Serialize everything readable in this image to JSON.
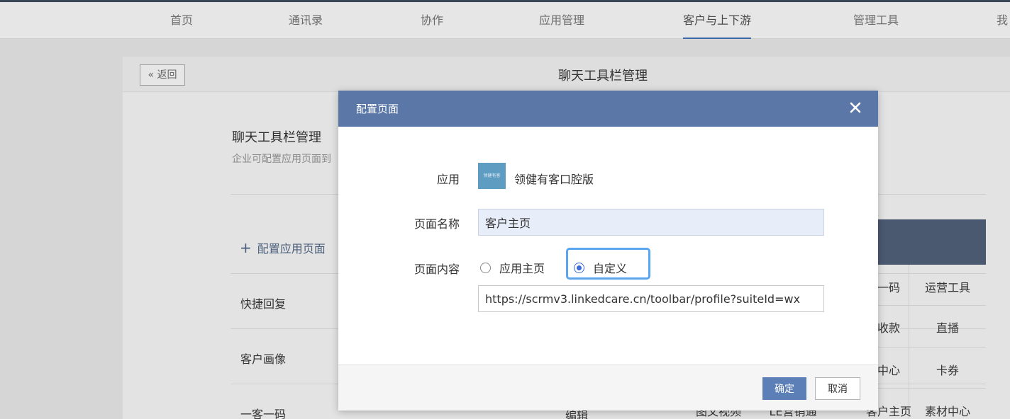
{
  "nav": {
    "items": [
      "首页",
      "通讯录",
      "协作",
      "应用管理",
      "客户与上下游",
      "管理工具",
      "我"
    ],
    "active_index": 4
  },
  "background": {
    "back_label": "« 返回",
    "page_title": "聊天工具栏管理",
    "section_title": "聊天工具栏管理",
    "section_desc": "企业可配置应用页面到",
    "add_label": "配置应用页面",
    "rows": [
      "快捷回复",
      "客户画像",
      "一客一码"
    ],
    "right_cells": [
      [
        "一码",
        "运营工具"
      ],
      [
        "收款",
        "直播"
      ],
      [
        "中心",
        "卡券"
      ],
      [
        "客户主页",
        "素材中心"
      ]
    ],
    "bottom_partial": [
      "编辑",
      "图文视频",
      "LE营销通"
    ]
  },
  "modal": {
    "title": "配置页面",
    "close_icon": "close-icon",
    "app_label": "应用",
    "app_logo_text": "领健有客",
    "app_name": "领健有客口腔版",
    "page_name_label": "页面名称",
    "page_name_value": "客户主页",
    "page_content_label": "页面内容",
    "radio_options": [
      "应用主页",
      "自定义"
    ],
    "radio_selected": 1,
    "url_value": "https://scrmv3.linkedcare.cn/toolbar/profile?suiteId=wx",
    "ok_label": "确定",
    "cancel_label": "取消"
  },
  "colors": {
    "modal_header": "#5b77a7",
    "primary_button": "#5b7fb6",
    "focus_ring": "#5aa5f0",
    "radio_selected": "#3b6bd6"
  }
}
